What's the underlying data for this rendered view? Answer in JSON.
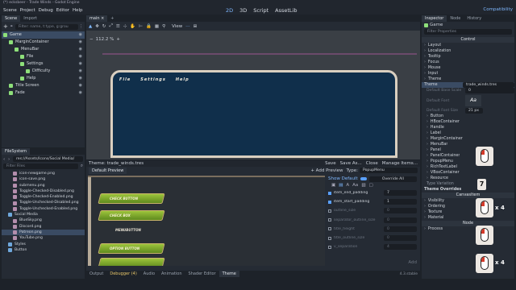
{
  "titlebar": {
    "title": "(*) ecksbeer - Trade Winds - Godot Engine"
  },
  "menubar": {
    "items": [
      "Scene",
      "Project",
      "Debug",
      "Editor",
      "Help"
    ],
    "workspaces": [
      "2D",
      "3D",
      "Script",
      "AssetLib"
    ],
    "renderer": "Compatibility"
  },
  "scene_dock": {
    "tabs": [
      "Scene",
      "Import"
    ],
    "filter_placeholder": "Filter: name, t:type, g:grou",
    "tree": [
      {
        "label": "Game",
        "depth": 0,
        "icon_color": "#8ee07a",
        "selected": true
      },
      {
        "label": "MarginContainer",
        "depth": 1,
        "icon_color": "#8ee07a"
      },
      {
        "label": "MenuBar",
        "depth": 2,
        "icon_color": "#8ee07a"
      },
      {
        "label": "File",
        "depth": 3,
        "icon_color": "#8ee07a"
      },
      {
        "label": "Settings",
        "depth": 3,
        "icon_color": "#8ee07a"
      },
      {
        "label": "Difficulty",
        "depth": 4,
        "icon_color": "#8ee07a"
      },
      {
        "label": "Help",
        "depth": 3,
        "icon_color": "#8ee07a"
      },
      {
        "label": "Title Screen",
        "depth": 1,
        "icon_color": "#8ee07a"
      },
      {
        "label": "Fade",
        "depth": 1,
        "icon_color": "#8ee07a"
      }
    ]
  },
  "filesystem_dock": {
    "title": "FileSystem",
    "path": "res://Assets/Icons/Social Media/",
    "filter_placeholder": "Filter Files",
    "items": [
      {
        "label": "icon-newgame.png",
        "depth": 2
      },
      {
        "label": "icon-save.png",
        "depth": 2
      },
      {
        "label": "submenu.png",
        "depth": 2
      },
      {
        "label": "Toggle-Checked-Disabled.png",
        "depth": 2
      },
      {
        "label": "Toggle-Checked-Enabled.png",
        "depth": 2
      },
      {
        "label": "Toggle-Unchecked-Disabled.png",
        "depth": 2
      },
      {
        "label": "Toggle-Unchecked-Enabled.png",
        "depth": 2
      },
      {
        "label": "Social Media",
        "depth": 1,
        "folder": true
      },
      {
        "label": "BlueSky.png",
        "depth": 2
      },
      {
        "label": "Discord.png",
        "depth": 2
      },
      {
        "label": "Patreon.png",
        "depth": 2,
        "selected": true
      },
      {
        "label": "YouTube.png",
        "depth": 2
      },
      {
        "label": "Styles",
        "depth": 1,
        "folder": true
      },
      {
        "label": "Button",
        "depth": 1,
        "folder": true
      }
    ]
  },
  "center": {
    "tab": "main",
    "zoom": "112.2 %",
    "view_label": "View",
    "menu_labels": [
      "File",
      "Settings",
      "Help"
    ]
  },
  "theme_editor": {
    "title": "Theme: trade_winds.tres",
    "actions": [
      "Save",
      "Save As...",
      "Close",
      "Manage Items..."
    ],
    "default_preview": "Default Preview",
    "add_preview": "+ Add Preview",
    "type_label": "Type:",
    "type_value": "PopupMenu",
    "show_default": "Show Default",
    "override_all": "Override All",
    "preview_buttons": [
      "CHECK BUTTON",
      "CHECK BOX",
      "MENUBUTTON",
      "OPTION BUTTON"
    ],
    "properties": [
      {
        "name": "item_end_padding",
        "value": "7",
        "active": true
      },
      {
        "name": "item_start_padding",
        "value": "1",
        "active": true
      },
      {
        "name": "outline_size",
        "value": "0",
        "active": false
      },
      {
        "name": "separator_outline_size",
        "value": "0",
        "active": false
      },
      {
        "name": "title_height",
        "value": "0",
        "active": false
      },
      {
        "name": "title_outline_size",
        "value": "0",
        "active": false
      },
      {
        "name": "v_separation",
        "value": "4",
        "active": false
      }
    ],
    "add_label": "Add"
  },
  "bottom_panel": {
    "tabs": [
      "Output",
      "Debugger (4)",
      "Audio",
      "Animation",
      "Shader Editor",
      "Theme"
    ],
    "version": "4.3.stable"
  },
  "inspector": {
    "tabs": [
      "Inspector",
      "Node",
      "History"
    ],
    "node": "Game",
    "filter_placeholder": "Filter Properties",
    "section": "Control",
    "groups": [
      "Layout",
      "Localization",
      "Tooltip",
      "Focus",
      "Mouse",
      "Input",
      "Theme"
    ],
    "theme_label": "Theme",
    "theme_value": "trade_winds.tres",
    "theme_rows": [
      {
        "name": "Default Base Scale",
        "value": "0"
      },
      {
        "name": "Default Font",
        "value": ""
      },
      {
        "name": "Default Font Size",
        "value": "21",
        "unit": "px"
      }
    ],
    "theme_types": [
      "Button",
      "HBoxContainer",
      "Handle",
      "Label",
      "MarginContainer",
      "MenuBar",
      "Panel",
      "PanelContainer",
      "PopupMenu",
      "RichTextLabel",
      "VBoxContainer",
      "Resource"
    ],
    "type_variation": "Type Variation",
    "theme_overrides": "Theme Overrides",
    "canvas_section": "CanvasItem",
    "canvas_groups": [
      "Visibility",
      "Ordering",
      "Texture",
      "Material"
    ],
    "node_section": "Node",
    "node_groups": [
      "Process"
    ]
  },
  "overlay": {
    "badges": [
      "7",
      "x 4",
      "x 4"
    ]
  }
}
